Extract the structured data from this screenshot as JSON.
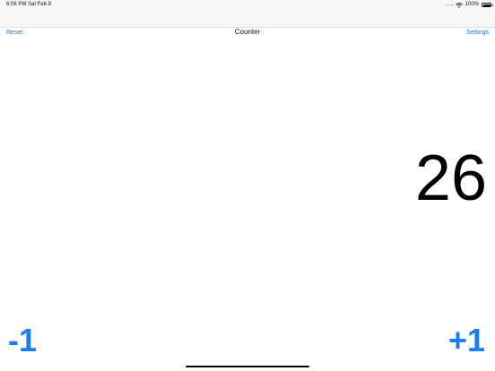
{
  "status_bar": {
    "time": "6:06 PM",
    "date": "Sat Feb 9",
    "battery_percent": "100%",
    "signal_icon": "signal-dots-icon",
    "wifi_icon": "wifi-icon",
    "battery_icon": "battery-icon",
    "battery_level": 1.0
  },
  "nav": {
    "left_label": "Reset",
    "title": "Counter",
    "right_label": "Settings"
  },
  "counter": {
    "value": "26"
  },
  "controls": {
    "decrement_label": "-1",
    "increment_label": "+1"
  },
  "colors": {
    "accent": "#1b7cf4",
    "text": "#000000",
    "background": "#ffffff"
  }
}
